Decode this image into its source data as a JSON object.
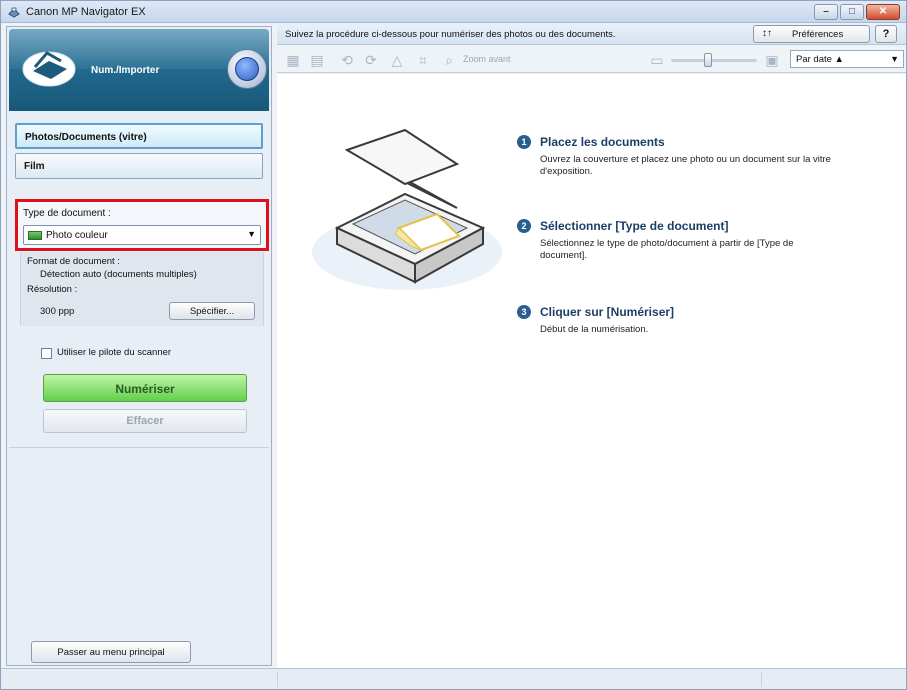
{
  "window": {
    "title": "Canon MP Navigator EX"
  },
  "left": {
    "mode_label": "Num./Importer",
    "sources": [
      "Photos/Documents (vitre)",
      "Film"
    ],
    "doc_type_label": "Type de document :",
    "doc_type_value": "Photo couleur",
    "format_label": "Format de document :",
    "format_value": "Détection auto (documents multiples)",
    "resolution_label": "Résolution :",
    "resolution_value": "300 ppp",
    "specify_button": "Spécifier...",
    "use_driver_label": "Utiliser le pilote du scanner",
    "scan_button": "Numériser",
    "clear_button": "Effacer",
    "main_menu_button": "Passer au menu principal"
  },
  "info_bar": {
    "text": "Suivez la procédure ci-dessous pour numériser des photos ou des documents.",
    "preferences_button": "Préférences",
    "help_button": "?"
  },
  "toolbar": {
    "zoom_label": "Zoom avant",
    "sort_value": "Par date ▲"
  },
  "steps": [
    {
      "num": "1",
      "title": "Placez les documents",
      "desc": "Ouvrez la couverture et placez une photo ou un document sur la vitre d'exposition."
    },
    {
      "num": "2",
      "title": "Sélectionner [Type de document]",
      "desc": "Sélectionnez le type de photo/document à partir de [Type de document]."
    },
    {
      "num": "3",
      "title": "Cliquer sur [Numériser]",
      "desc": "Début de la numérisation."
    }
  ]
}
